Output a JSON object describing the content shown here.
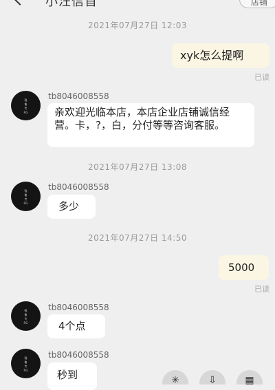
{
  "header": {
    "title": "小汪信首",
    "right_button": "店铺"
  },
  "messages": {
    "ts1": "2021年07月27日 12:03",
    "out1": "xyk怎么提啊",
    "read1": "已读",
    "sender1": "tb8046008558",
    "in1": "亲欢迎光临本店，本店企业店铺诚信经营。卡，?，白，分付等等咨询客服。",
    "ts2": "2021年07月27日 13:08",
    "sender2": "tb8046008558",
    "in2": "多少",
    "ts3": "2021年07月27日 14:50",
    "out2": "5000",
    "read2": "已读",
    "sender3": "tb8046008558",
    "in3": "4个点",
    "sender4": "tb8046008558",
    "in4": "秒到"
  },
  "avatar_text": [
    "鞋",
    "鲁",
    "专",
    "RG"
  ],
  "icons": [
    "back-icon",
    "sparkle-icon",
    "download-icon",
    "grid-icon"
  ]
}
